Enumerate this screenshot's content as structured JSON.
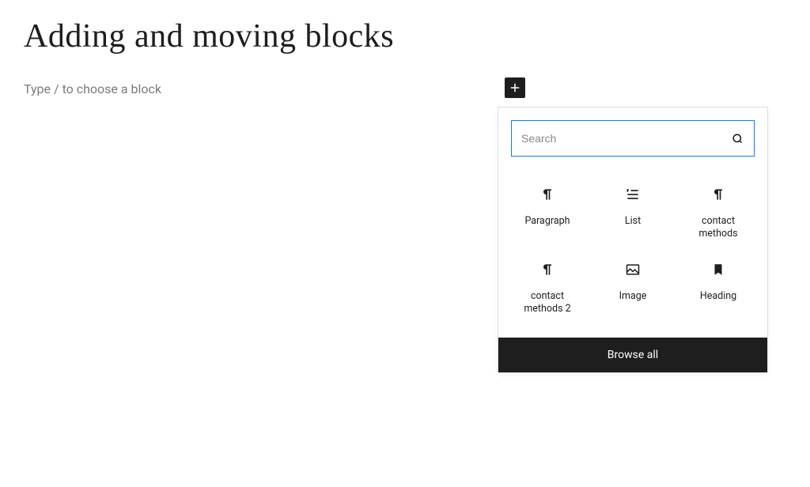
{
  "title": "Adding and moving blocks",
  "placeholder_prompt": "Type / to choose a block",
  "inserter": {
    "search_placeholder": "Search",
    "browse_all_label": "Browse all",
    "blocks": [
      {
        "label": "Paragraph",
        "icon": "paragraph-icon"
      },
      {
        "label": "List",
        "icon": "list-icon"
      },
      {
        "label": "contact methods",
        "icon": "paragraph-icon"
      },
      {
        "label": "contact methods 2",
        "icon": "paragraph-icon"
      },
      {
        "label": "Image",
        "icon": "image-icon"
      },
      {
        "label": "Heading",
        "icon": "bookmark-icon"
      }
    ]
  }
}
